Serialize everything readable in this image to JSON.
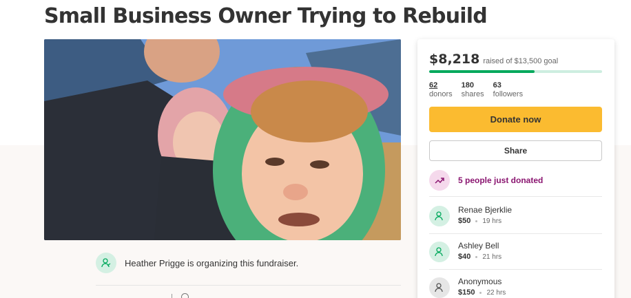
{
  "page": {
    "title": "Small Business Owner Trying to Rebuild"
  },
  "organizer": {
    "icon": "person-leaf-icon",
    "text": "Heather Prigge is organizing this fundraiser."
  },
  "donation_card": {
    "amount_raised": "$8,218",
    "goal_text": "raised of $13,500 goal",
    "progress_fraction": 0.61,
    "stats": [
      {
        "value": "62",
        "label": "donors"
      },
      {
        "value": "180",
        "label": "shares"
      },
      {
        "value": "63",
        "label": "followers"
      }
    ],
    "donate_label": "Donate now",
    "share_label": "Share",
    "recent_text": "5 people just donated",
    "donations": [
      {
        "name": "Renae Bjerklie",
        "amount": "$50",
        "time": "19 hrs"
      },
      {
        "name": "Ashley Bell",
        "amount": "$40",
        "time": "21 hrs"
      },
      {
        "name": "Anonymous",
        "amount": "$150",
        "time": "22 hrs"
      }
    ]
  },
  "colors": {
    "brand_green": "#02a95c",
    "donate_yellow": "#fbbb30",
    "recent_purple": "#8a1570"
  }
}
